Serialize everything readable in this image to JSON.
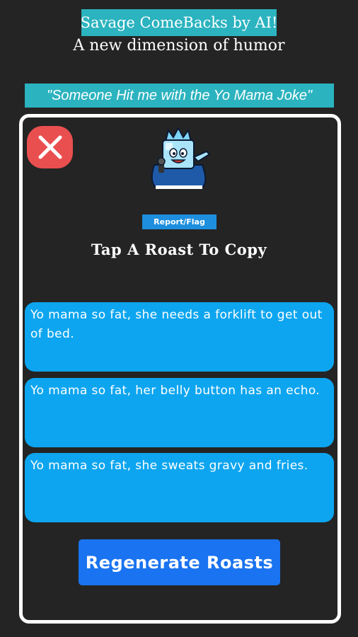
{
  "header": {
    "title": "Savage ComeBacks by AI!",
    "subtitle": "A new dimension of humor"
  },
  "prompt": {
    "text": "\"Someone Hit me with the Yo Mama Joke\""
  },
  "dialog": {
    "close_icon": "close-x-icon",
    "mascot_icon": "ice-king-mascot",
    "report_label": "Report/Flag",
    "instruction": "Tap A Roast To Copy",
    "roasts": [
      "Yo mama so fat, she needs a forklift to get out of bed.",
      "Yo mama so fat, her belly button has an echo.",
      "Yo mama so fat, she sweats gravy and fries."
    ],
    "regenerate_label": "Regenerate Roasts"
  },
  "colors": {
    "background": "#242424",
    "banner": "#2bb3bf",
    "card": "#0da5ef",
    "button": "#1a73f0",
    "close": "#ea4f4f"
  }
}
